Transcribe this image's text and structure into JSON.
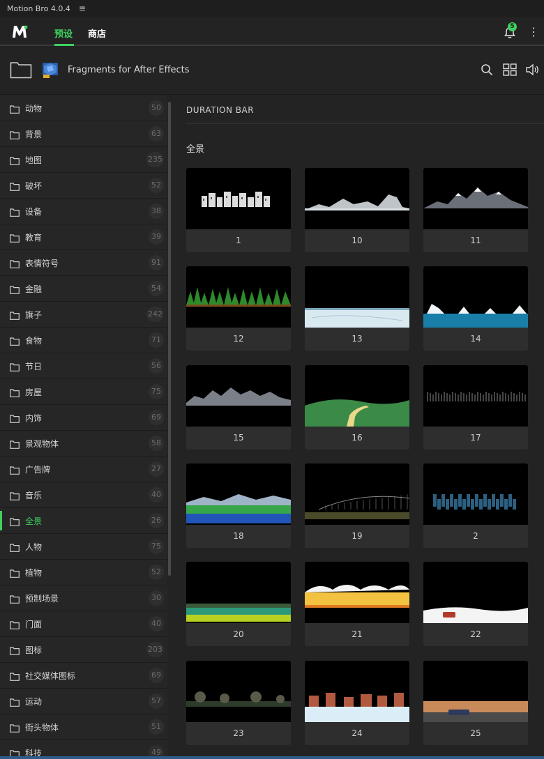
{
  "app": {
    "title": "Motion Bro 4.0.4"
  },
  "nav": {
    "tab_presets": "预设",
    "tab_store": "商店",
    "notifications": "5"
  },
  "library": {
    "pack_title": "Fragments for After Effects"
  },
  "sidebar": {
    "items": [
      {
        "label": "动物",
        "count": "50"
      },
      {
        "label": "背景",
        "count": "63"
      },
      {
        "label": "地图",
        "count": "235"
      },
      {
        "label": "破坏",
        "count": "52"
      },
      {
        "label": "设备",
        "count": "38"
      },
      {
        "label": "教育",
        "count": "39"
      },
      {
        "label": "表情符号",
        "count": "91"
      },
      {
        "label": "金融",
        "count": "54"
      },
      {
        "label": "旗子",
        "count": "242"
      },
      {
        "label": "食物",
        "count": "71"
      },
      {
        "label": "节日",
        "count": "56"
      },
      {
        "label": "房屋",
        "count": "75"
      },
      {
        "label": "内饰",
        "count": "69"
      },
      {
        "label": "景观物体",
        "count": "58"
      },
      {
        "label": "广告牌",
        "count": "27"
      },
      {
        "label": "音乐",
        "count": "40"
      },
      {
        "label": "全景",
        "count": "26"
      },
      {
        "label": "人物",
        "count": "75"
      },
      {
        "label": "植物",
        "count": "52"
      },
      {
        "label": "预制场景",
        "count": "30"
      },
      {
        "label": "门面",
        "count": "40"
      },
      {
        "label": "图标",
        "count": "203"
      },
      {
        "label": "社交媒体图标",
        "count": "69"
      },
      {
        "label": "运动",
        "count": "57"
      },
      {
        "label": "街头物体",
        "count": "51"
      },
      {
        "label": "科技",
        "count": "49"
      }
    ]
  },
  "content": {
    "section_title": "DURATION BAR",
    "category_title": "全景",
    "presets": [
      "1",
      "10",
      "11",
      "12",
      "13",
      "14",
      "15",
      "16",
      "17",
      "18",
      "19",
      "2",
      "20",
      "21",
      "22",
      "23",
      "24",
      "25"
    ]
  },
  "colors": {
    "accent": "#3fd15f",
    "background": "#232323",
    "sidebar": "#262626"
  }
}
